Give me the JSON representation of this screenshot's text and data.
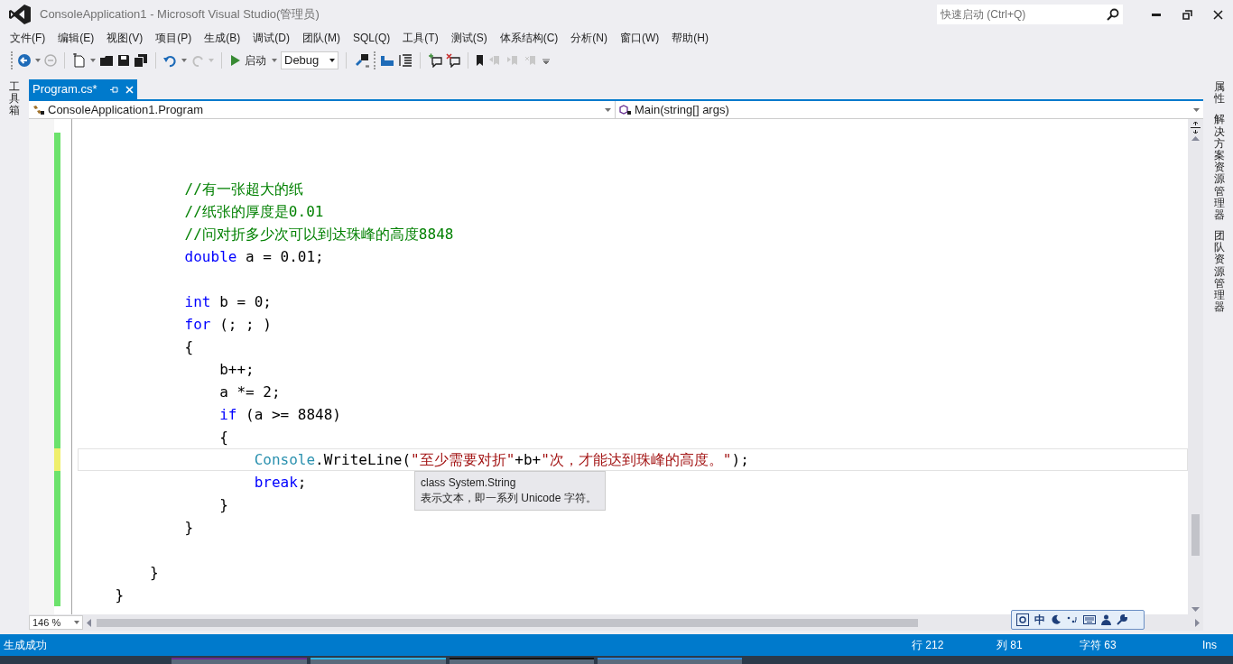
{
  "window": {
    "title": "ConsoleApplication1 - Microsoft Visual Studio(管理员)",
    "quick_launch": {
      "placeholder": "快速启动 (Ctrl+Q)"
    }
  },
  "menu": [
    "文件(F)",
    "编辑(E)",
    "视图(V)",
    "项目(P)",
    "生成(B)",
    "调试(D)",
    "团队(M)",
    "SQL(Q)",
    "工具(T)",
    "测试(S)",
    "体系结构(C)",
    "分析(N)",
    "窗口(W)",
    "帮助(H)"
  ],
  "toolbar": {
    "start_label": "启动",
    "configuration": "Debug"
  },
  "left_panel_tab": "工具箱",
  "tabs": [
    {
      "label": "Program.cs*",
      "selected": true
    }
  ],
  "nav_bar": {
    "type_dropdown": "ConsoleApplication1.Program",
    "member_dropdown": "Main(string[] args)"
  },
  "code_lines": [
    {
      "kind": "blank",
      "unsaved": false,
      "current": false
    },
    {
      "kind": "blank",
      "unsaved": false,
      "current": false
    },
    {
      "kind": "code",
      "unsaved": false,
      "current": false,
      "tokens": [
        {
          "kind": "comment",
          "text": "            //有一张超大的纸"
        }
      ]
    },
    {
      "kind": "code",
      "unsaved": false,
      "current": false,
      "tokens": [
        {
          "kind": "comment",
          "text": "            //纸张的厚度是0.01"
        }
      ]
    },
    {
      "kind": "code",
      "unsaved": false,
      "current": false,
      "tokens": [
        {
          "kind": "comment",
          "text": "            //问对折多少次可以到达珠峰的高度8848"
        }
      ]
    },
    {
      "kind": "code",
      "unsaved": false,
      "current": false,
      "tokens": [
        {
          "kind": "keyword",
          "text": "            double"
        },
        {
          "kind": "plain",
          "text": " a = 0.01;"
        }
      ]
    },
    {
      "kind": "blank",
      "unsaved": false,
      "current": false
    },
    {
      "kind": "code",
      "unsaved": false,
      "current": false,
      "tokens": [
        {
          "kind": "keyword",
          "text": "            int"
        },
        {
          "kind": "plain",
          "text": " b = 0;"
        }
      ]
    },
    {
      "kind": "code",
      "unsaved": false,
      "current": false,
      "tokens": [
        {
          "kind": "keyword",
          "text": "            for"
        },
        {
          "kind": "plain",
          "text": " (; ; )"
        }
      ]
    },
    {
      "kind": "code",
      "unsaved": false,
      "current": false,
      "tokens": [
        {
          "kind": "plain",
          "text": "            {"
        }
      ]
    },
    {
      "kind": "code",
      "unsaved": false,
      "current": false,
      "tokens": [
        {
          "kind": "plain",
          "text": "                b++;"
        }
      ]
    },
    {
      "kind": "code",
      "unsaved": false,
      "current": false,
      "tokens": [
        {
          "kind": "plain",
          "text": "                a *= 2;"
        }
      ]
    },
    {
      "kind": "code",
      "unsaved": false,
      "current": false,
      "tokens": [
        {
          "kind": "keyword",
          "text": "                if"
        },
        {
          "kind": "plain",
          "text": " (a >= 8848)"
        }
      ]
    },
    {
      "kind": "code",
      "unsaved": false,
      "current": false,
      "tokens": [
        {
          "kind": "plain",
          "text": "                {"
        }
      ]
    },
    {
      "kind": "code",
      "unsaved": true,
      "current": true,
      "tokens": [
        {
          "kind": "type",
          "text": "                    Console"
        },
        {
          "kind": "plain",
          "text": ".WriteLine("
        },
        {
          "kind": "string",
          "text": "\"至少需要对折\""
        },
        {
          "kind": "plain",
          "text": "+b+"
        },
        {
          "kind": "string",
          "text": "\"次，才能达到珠峰的高度。\""
        },
        {
          "kind": "plain",
          "text": ");"
        }
      ]
    },
    {
      "kind": "code",
      "unsaved": false,
      "current": false,
      "tokens": [
        {
          "kind": "keyword",
          "text": "                    break"
        },
        {
          "kind": "plain",
          "text": ";"
        }
      ]
    },
    {
      "kind": "code",
      "unsaved": false,
      "current": false,
      "tokens": [
        {
          "kind": "plain",
          "text": "                }"
        }
      ]
    },
    {
      "kind": "code",
      "unsaved": false,
      "current": false,
      "tokens": [
        {
          "kind": "plain",
          "text": "            }"
        }
      ]
    },
    {
      "kind": "blank",
      "unsaved": false,
      "current": false
    },
    {
      "kind": "code",
      "unsaved": false,
      "current": false,
      "tokens": [
        {
          "kind": "plain",
          "text": "        }"
        }
      ]
    },
    {
      "kind": "code",
      "unsaved": false,
      "current": false,
      "tokens": [
        {
          "kind": "plain",
          "text": "    }"
        }
      ]
    }
  ],
  "tooltip": {
    "title": "class System.String",
    "description": "表示文本，即一系列 Unicode 字符。"
  },
  "zoom": "146 %",
  "ime_toolbar": {
    "mode": "中"
  },
  "right_panel_tabs": [
    "属性",
    "解决方案资源管理器",
    "团队资源管理器"
  ],
  "status_bar": {
    "message": "生成成功",
    "line": "行 212",
    "column": "列 81",
    "char": "字符 63",
    "mode": "Ins"
  }
}
